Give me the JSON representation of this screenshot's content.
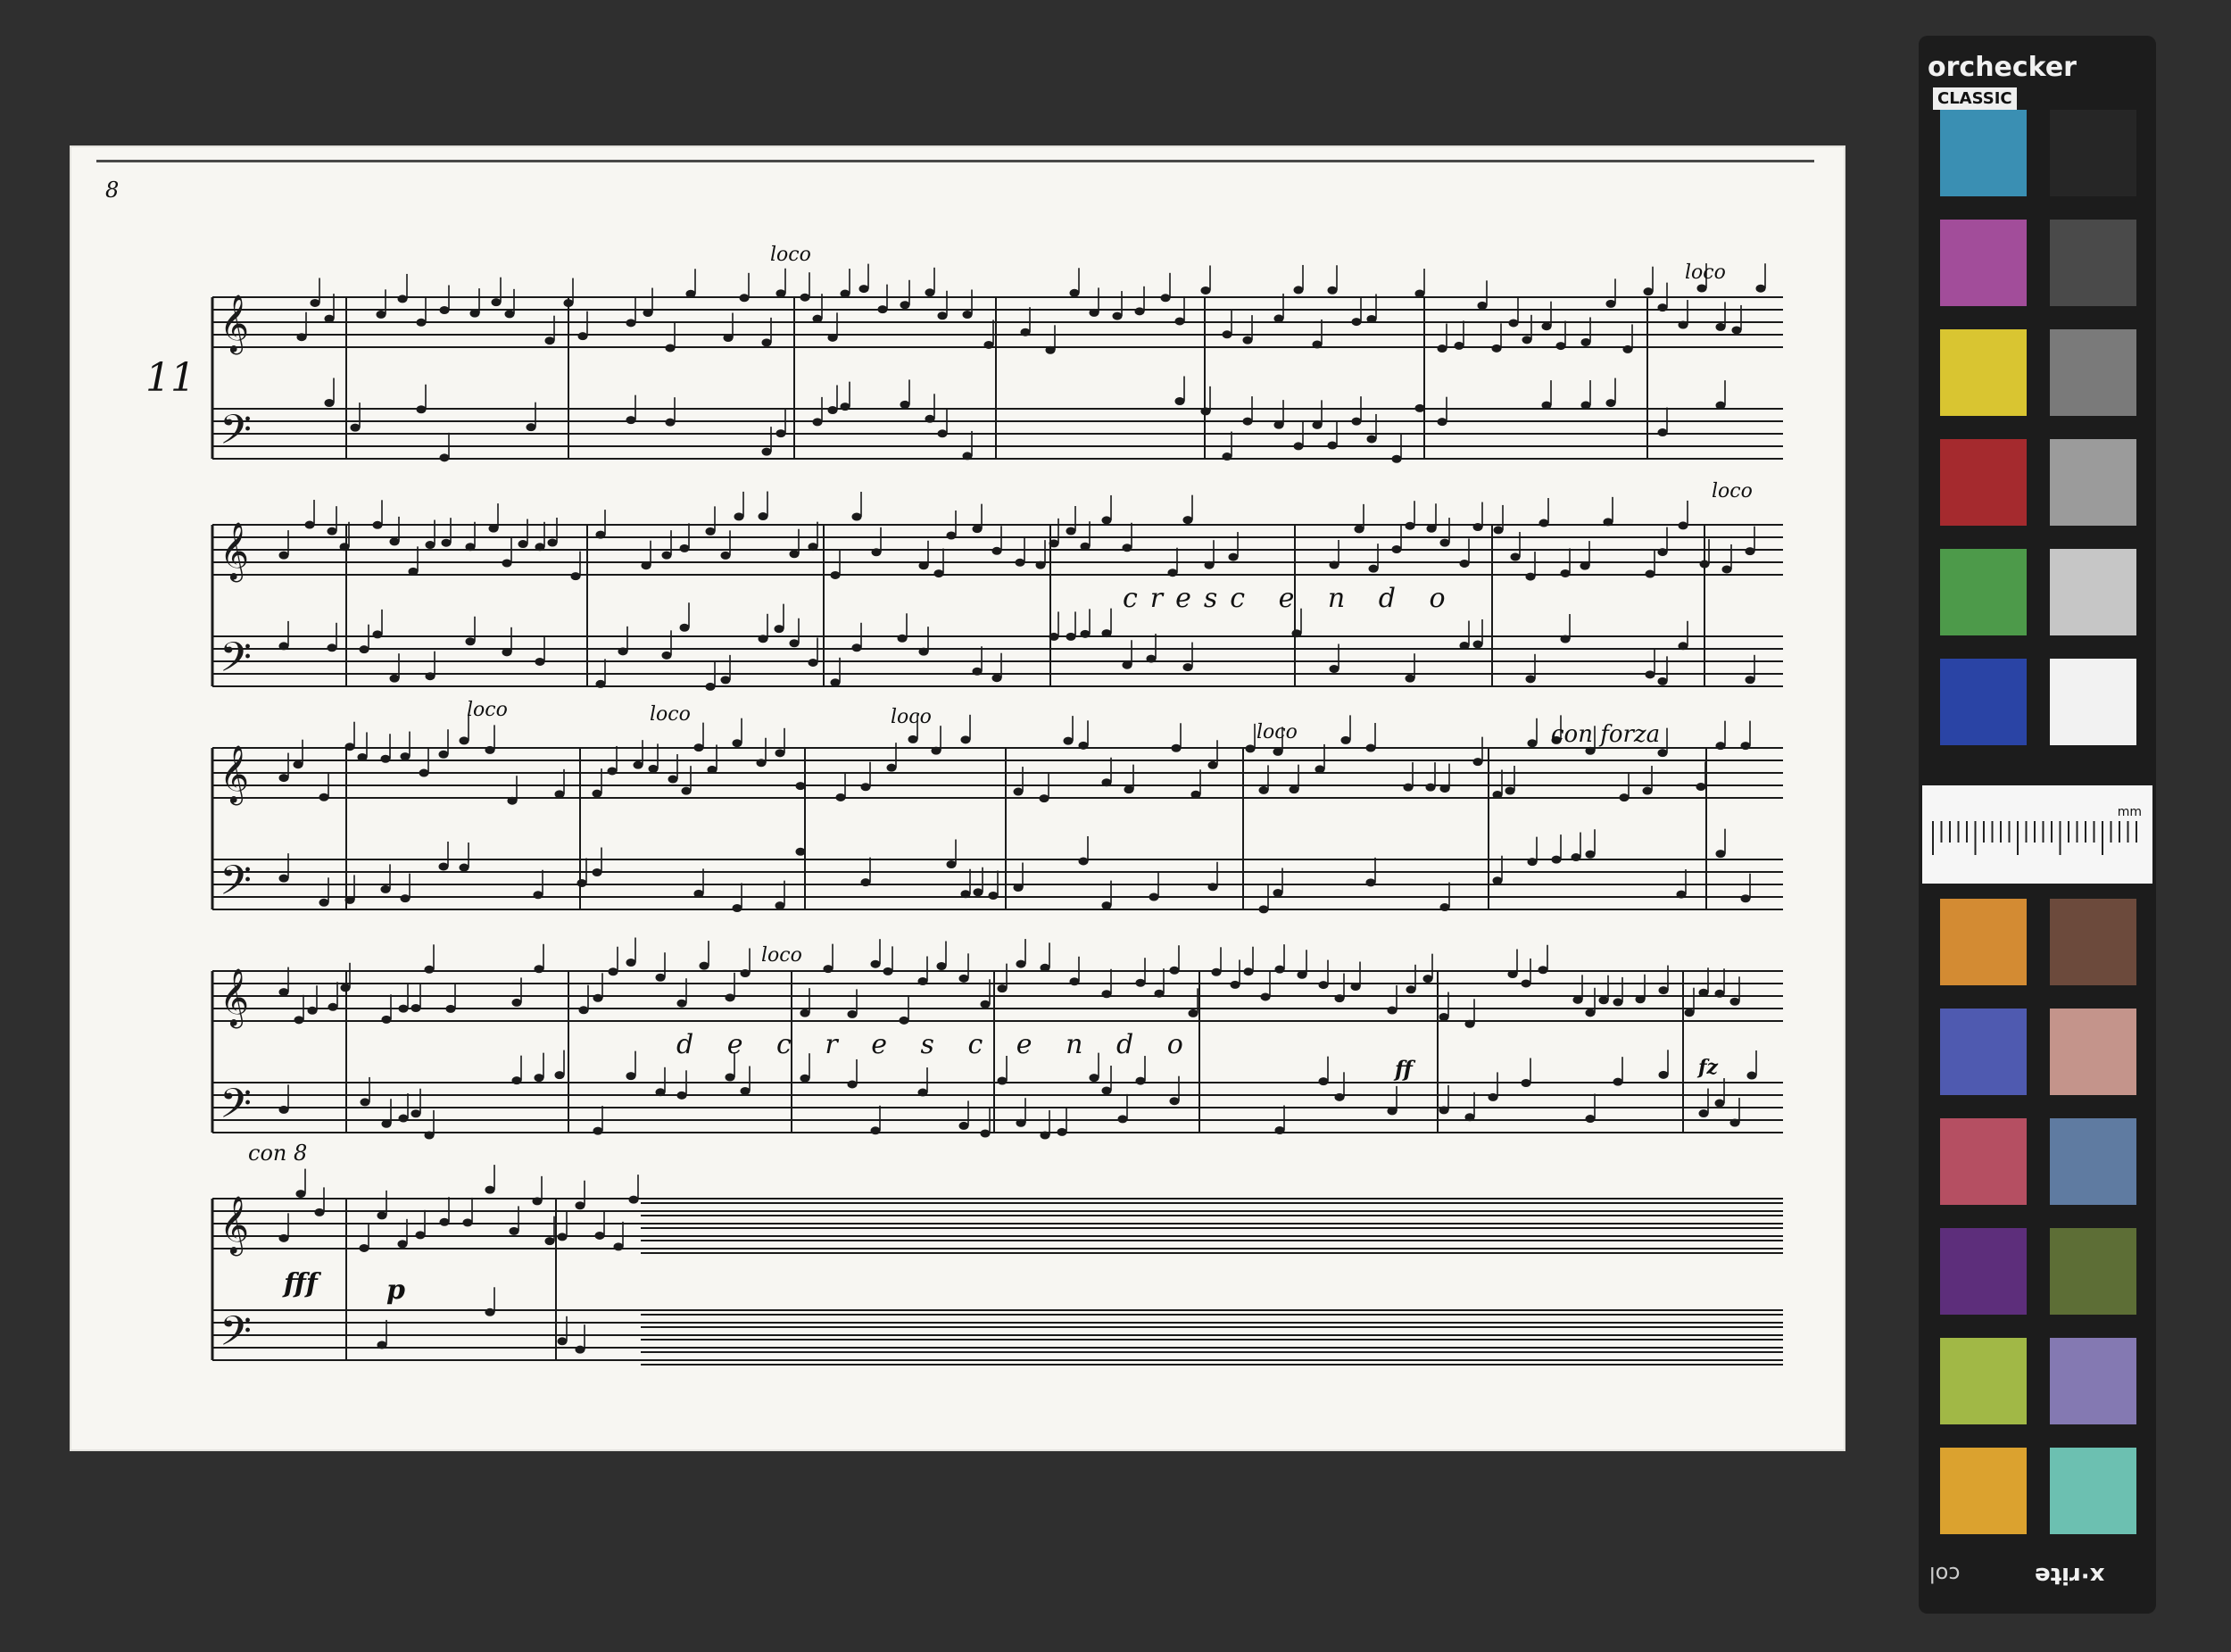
{
  "sheet": {
    "page_number": "8",
    "margin_mark": "11",
    "annotations": {
      "loco_1": "loco",
      "loco_2": "loco",
      "loco_3": "loco",
      "loco_4": "loco",
      "loco_5": "loco",
      "loco_6": "loco",
      "loco_7": "loco",
      "loco_8": "loco",
      "crescendo": "cresc e n d o",
      "con_forza": "con forza",
      "decrescendo": "d e c r e s c e n d o",
      "con8": "con 8",
      "fff": "fff",
      "p": "p",
      "ff": "ff",
      "fz": "fz"
    }
  },
  "checker": {
    "brand": "orchecker",
    "classic": "CLASSIC",
    "mm_label": "mm",
    "xrite": "x·rite",
    "col": "col",
    "top_patches": [
      "#3a8fb3",
      "#262626",
      "#a24d9a",
      "#4a4a4a",
      "#d9c531",
      "#7a7a7a",
      "#a52a2e",
      "#9b9b9b",
      "#4d9a4a",
      "#c6c6c6",
      "#2a44a5",
      "#f2f2f2"
    ],
    "bottom_patches": [
      "#d38b33",
      "#6c4a3c",
      "#4f5ab0",
      "#c4948b",
      "#b54f62",
      "#5f7ba1",
      "#5d2e7b",
      "#5d6e36",
      "#a1b846",
      "#8479b2",
      "#dba22f",
      "#6cc0b1"
    ]
  }
}
